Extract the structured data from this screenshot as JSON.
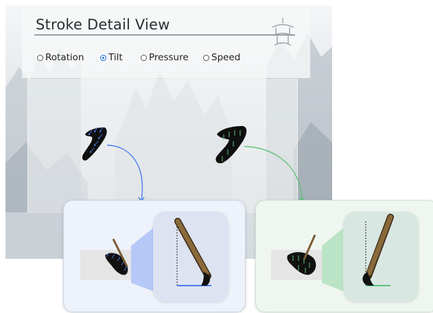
{
  "window": {
    "title": "Stroke Detail View"
  },
  "view_options": {
    "selected": "Tilt",
    "items": [
      {
        "label": "Rotation",
        "selected": false
      },
      {
        "label": "Tilt",
        "selected": true
      },
      {
        "label": "Pressure",
        "selected": false
      },
      {
        "label": "Speed",
        "selected": false
      }
    ]
  },
  "colors": {
    "selected_radio": "#1e6fe0",
    "tilt_blue": "#4a7cf0",
    "tilt_green": "#5cc27a",
    "brush_handle": "#7a5a32",
    "ink": "#111111"
  },
  "icons": {
    "pagoda": "pagoda-icon",
    "brush": "brush-icon"
  }
}
